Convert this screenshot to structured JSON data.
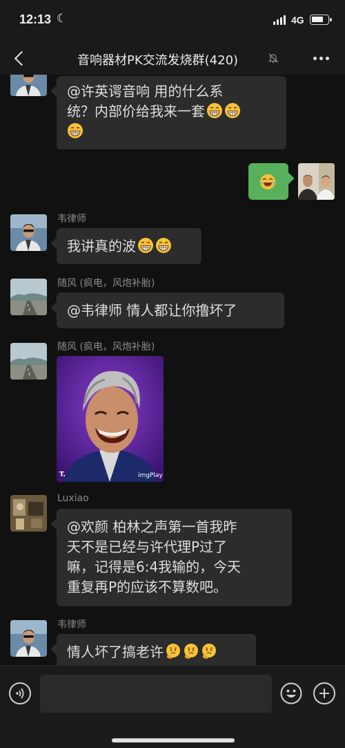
{
  "status_bar": {
    "time": "12:13",
    "network": "4G"
  },
  "header": {
    "title": "音响器材PK交流发烧群(420)"
  },
  "messages": [
    {
      "sender": "",
      "lines": [
        "@许英谔音响 用的什么系",
        "统？内部价给我来一套"
      ],
      "emoji": "grin-emoji"
    },
    {
      "sender": "",
      "mine": true,
      "emoji": "laugh-emoji"
    },
    {
      "sender": "韦律师",
      "lines": [
        "我讲真的波"
      ],
      "emoji": "grin-emoji"
    },
    {
      "sender": "随风 (疯电，风炮补胎)",
      "lines": [
        "@韦律师 情人都让你撸坏了"
      ]
    },
    {
      "sender": "随风 (疯电，风炮补胎)",
      "image_caption": "imgPlay",
      "image_corner": "T."
    },
    {
      "sender": "Luxiao",
      "lines": [
        "@欢颜 柏林之声第一首我昨",
        "天不是已经与许代理P过了",
        "嘛，记得是6:4我输的，今天",
        "重复再P的应该不算数吧。"
      ]
    },
    {
      "sender": "韦律师",
      "lines": [
        "情人坏了搞老许"
      ],
      "emoji": "thinking-emoji"
    }
  ],
  "input_bar": {
    "placeholder": ""
  },
  "colors": {
    "background": "#111111",
    "bubble": "#2c2c2c",
    "my_bubble": "#58b05d",
    "sender_text": "#8a8a8a"
  }
}
